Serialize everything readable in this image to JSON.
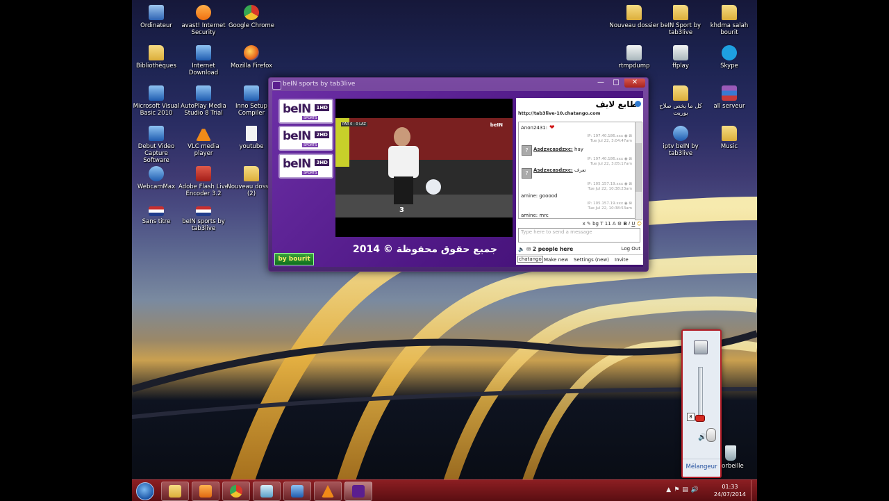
{
  "desktop_icons": {
    "ordinateur": "Ordinateur",
    "avast": "avast! Internet Security",
    "chrome": "Google Chrome",
    "nouveau_dossier": "Nouveau dossier",
    "bein_folder": "beIN Sport by tab3live",
    "khdma": "khdma salah bourit",
    "bibliotheques": "Bibliothèques",
    "internet_download": "Internet Download",
    "firefox": "Mozilla Firefox",
    "rtmpdump": "rtmpdump",
    "ffplay": "ffplay",
    "skype": "Skype",
    "vb2010": "Microsoft Visual Basic 2010",
    "autoplay": "AutoPlay Media Studio 8 Trial",
    "inno": "Inno Setup Compiler",
    "arabic_folder": "كل ما يخص صلاح بوريت",
    "all_serveur": "all serveur",
    "debut": "Debut Video Capture Software",
    "vlc": "VLC media player",
    "youtube": "youtube",
    "iptv": "iptv beIN by tab3live",
    "music": "Music",
    "webcammax": "WebcamMax",
    "flash_encoder": "Adobe Flash Live Encoder 3.2",
    "nouveau_dossier2": "Nouveau dossier (2)",
    "sans_titre": "Sans titre",
    "bein_app": "beIN sports by tab3live",
    "corbeille": "Corbeille"
  },
  "app_window": {
    "title": "beIN sports by tab3live",
    "channels": [
      {
        "brand": "beIN",
        "tag": "1HD",
        "sub": "SPORTS"
      },
      {
        "brand": "beIN",
        "tag": "2HD",
        "sub": "SPORTS"
      },
      {
        "brand": "beIN",
        "tag": "3HD",
        "sub": "SPORTS"
      }
    ],
    "copyright": "جميع حقوق محفوظة © 2014",
    "credit": "by bourit",
    "video": {
      "score": "PAR 0 - 0 LAZ",
      "channel_bug": "beIN",
      "player_number": "3"
    }
  },
  "chat": {
    "title": "طابع لايف",
    "url": "http://tab3live-10.chatango.com",
    "messages": [
      {
        "user": "Anon2431:",
        "text": "",
        "ip": "",
        "time": ""
      },
      {
        "user": "Asdzxcasdzxc:",
        "text": "hay",
        "ip": "IP: 197.40.186.xxx",
        "time": "Tue Jul 22, 3:04:47am"
      },
      {
        "user": "Asdzxcasdzxc:",
        "text": "تعرف",
        "ip": "IP: 197.40.186.xxx",
        "time": "Tue Jul 22, 3:05:17am"
      },
      {
        "user": "amine:",
        "text": "gooood",
        "ip": "IP: 105.157.19.xxx",
        "time": "Tue Jul 22, 10:38:23am"
      },
      {
        "user": "amine:",
        "text": "mrc",
        "ip": "IP: 105.157.19.xxx",
        "time": "Tue Jul 22, 10:38:53am"
      }
    ],
    "input_placeholder": "Type here to send a message",
    "people_here": "2 people here",
    "logout": "Log Out",
    "bottom": {
      "brand": "chatango",
      "make_new": "Make new",
      "settings": "Settings (new)",
      "invite": "Invite"
    }
  },
  "mixer": {
    "level": "8",
    "label": "Mélangeur"
  },
  "taskbar": {
    "time": "01:33",
    "date": "24/07/2014"
  }
}
